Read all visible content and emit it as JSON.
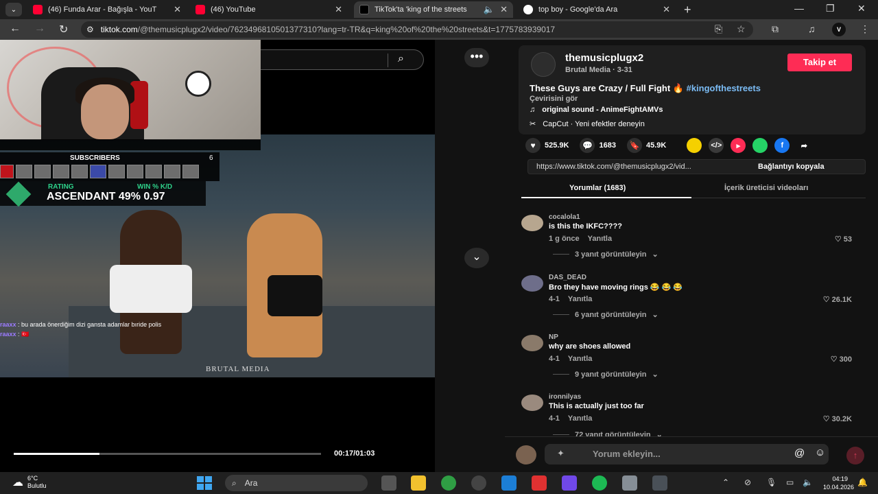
{
  "browser": {
    "tabs": [
      {
        "title": "(46) Funda Arar - Bağışla - YouT",
        "favicon_color": "#ff0033"
      },
      {
        "title": "(46) YouTube",
        "favicon_color": "#ff0033"
      },
      {
        "title": "TikTok'ta 'king of the streets",
        "favicon_color": "#000000",
        "active": true
      },
      {
        "title": "top boy - Google'da Ara",
        "favicon_color": "#4285f4"
      }
    ],
    "url_host": "tiktok.com",
    "url_path": "/@themusicplugx2/video/7623496810501377310?lang=tr-TR&q=king%20of%20the%20streets&t=1775783939017",
    "profile_initial": "V"
  },
  "stream_overlay": {
    "subscribers_label": "SUBSCRIBERS",
    "subscribers_count": "6",
    "rating_label": "RATING",
    "win_label": "WIN % K/D",
    "rank_value": "ASCENDANT 49% 0.97",
    "chat": [
      {
        "user": "raaxx",
        "message": "bu arada önerdiğim dizi gansta adamlar bıride polis"
      },
      {
        "user": "raaxx",
        "message": "🇹🇷"
      }
    ],
    "watermark": "BRUTAL MEDIA"
  },
  "player": {
    "time": "00:17/01:03",
    "progress": 0.28
  },
  "video_info": {
    "author_name": "themusicplugx2",
    "author_meta": "Brutal Media · 3-31",
    "follow_label": "Takip et",
    "description": "These Guys are Crazy / Full Fight 🔥",
    "hashtag": "#kingofthestreets",
    "translate_label": "Çevirisini gör",
    "sound": "original sound - AnimeFightAMVs",
    "capcut": "CapCut · Yeni efektler deneyin",
    "likes": "525.9K",
    "comments": "1683",
    "saves": "45.9K",
    "share_colors": [
      "#f5d000",
      "#3a3a3a",
      "#fe2c55",
      "#25d366",
      "#1877f2"
    ],
    "link": "https://www.tiktok.com/@themusicplugx2/vid...",
    "copy_label": "Bağlantıyı kopyala"
  },
  "comment_tabs": {
    "comments_tab": "Yorumlar (1683)",
    "creator_tab": "İçerik üreticisi videoları"
  },
  "comments": [
    {
      "user": "cocalola1",
      "text": "is this the IKFC????",
      "time": "1 g önce",
      "reply": "Yanıtla",
      "likes": "53",
      "view": "3 yanıt görüntüleyin"
    },
    {
      "user": "DAS_DEAD",
      "text": "Bro they have moving rings 😂 😂 😂",
      "time": "4-1",
      "reply": "Yanıtla",
      "likes": "26.1K",
      "view": "6 yanıt görüntüleyin"
    },
    {
      "user": "NP",
      "text": "why are shoes allowed",
      "time": "4-1",
      "reply": "Yanıtla",
      "likes": "300",
      "view": "9 yanıt görüntüleyin"
    },
    {
      "user": "ironnilyas",
      "text": "This is actually just too far",
      "time": "4-1",
      "reply": "Yanıtla",
      "likes": "30.2K",
      "view": "72 yanıt görüntüleyin"
    }
  ],
  "comment_box": {
    "placeholder": "Yorum ekleyin..."
  },
  "taskbar": {
    "temp": "6°C",
    "weather": "Bulutlu",
    "search": "Ara",
    "time": "04:19",
    "date": "10.04.2026"
  }
}
